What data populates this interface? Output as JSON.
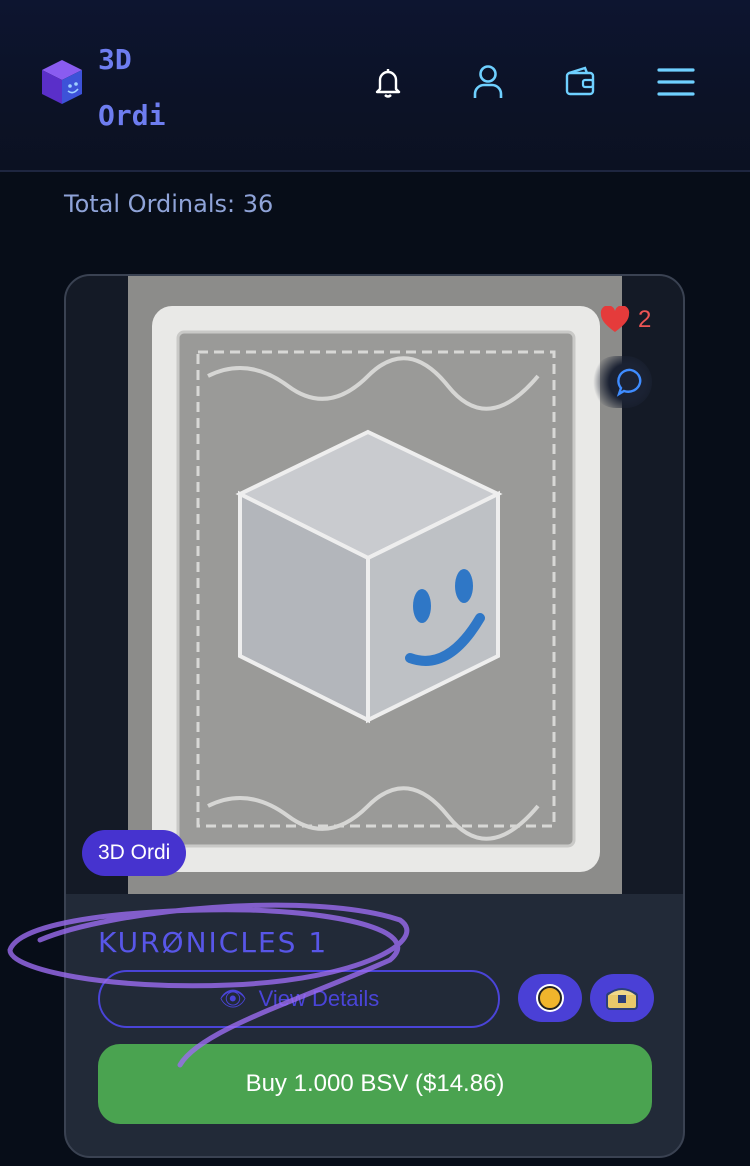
{
  "header": {
    "brand_line1": "3D",
    "brand_line2": "Ordi",
    "icons": [
      "bell-icon",
      "user-icon",
      "wallet-icon",
      "menu-icon"
    ]
  },
  "summary": {
    "total_text": "Total Ordinals: 36"
  },
  "card": {
    "likes": "2",
    "collection_badge": "3D Ordi",
    "title": "KURØNICLES 1",
    "view_label": "View Details",
    "buy_label": "Buy 1.000 BSV ($14.86)",
    "coin_buttons": [
      "coin-icon",
      "chest-icon"
    ]
  },
  "colors": {
    "accent": "#5856e8",
    "badge": "#4633cf",
    "buy": "#4aa350",
    "like": "#e55555"
  }
}
